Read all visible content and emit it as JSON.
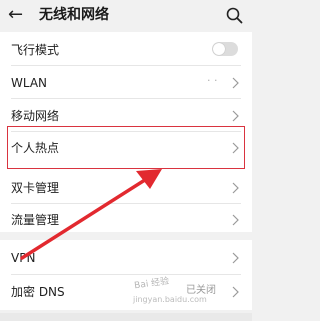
{
  "header": {
    "back_icon": "arrow-left-icon",
    "title": "无线和网络",
    "search_icon": "search-icon"
  },
  "group1": {
    "items": [
      {
        "label": "飞行模式",
        "control": "toggle",
        "toggle_on": false
      },
      {
        "label": "WLAN",
        "control": "chevron",
        "status": "· ·"
      },
      {
        "label": "移动网络",
        "control": "chevron"
      },
      {
        "label": "个人热点",
        "control": "chevron",
        "highlighted": true
      },
      {
        "label": "双卡管理",
        "control": "chevron"
      },
      {
        "label": "流量管理",
        "control": "chevron"
      }
    ]
  },
  "group2": {
    "items": [
      {
        "label": "VPN",
        "control": "chevron"
      },
      {
        "label": "加密 DNS",
        "control": "chevron",
        "status": "已关闭"
      }
    ]
  },
  "annotations": {
    "highlight_color": "#d9333f",
    "arrow_color": "#e2292f"
  },
  "watermark": {
    "text": "Bai 经验",
    "url_text": "jingyan.baidu.com"
  }
}
